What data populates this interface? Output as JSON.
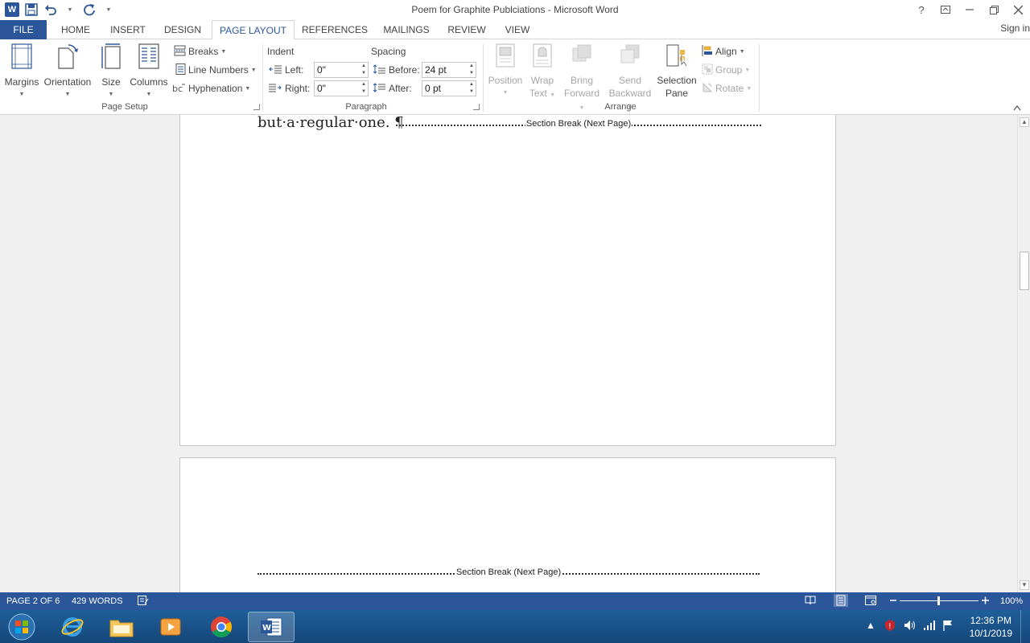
{
  "window": {
    "title": "Poem for Graphite Publciations - Microsoft Word",
    "app_icon": "W",
    "controls": [
      "?",
      "ribbon-display",
      "minimize",
      "restore",
      "close"
    ]
  },
  "tabs": [
    {
      "label": "FILE"
    },
    {
      "label": "HOME"
    },
    {
      "label": "INSERT"
    },
    {
      "label": "DESIGN"
    },
    {
      "label": "PAGE LAYOUT",
      "active": true
    },
    {
      "label": "REFERENCES"
    },
    {
      "label": "MAILINGS"
    },
    {
      "label": "REVIEW"
    },
    {
      "label": "VIEW"
    }
  ],
  "signin": "Sign in",
  "ribbon": {
    "page_setup": {
      "label": "Page Setup",
      "margins": "Margins",
      "orientation": "Orientation",
      "size": "Size",
      "columns": "Columns",
      "breaks": "Breaks",
      "line_numbers": "Line Numbers",
      "hyphenation": "Hyphenation"
    },
    "paragraph": {
      "label": "Paragraph",
      "indent_header": "Indent",
      "spacing_header": "Spacing",
      "left_label": "Left:",
      "left_value": "0\"",
      "right_label": "Right:",
      "right_value": "0\"",
      "before_label": "Before:",
      "before_value": "24 pt",
      "after_label": "After:",
      "after_value": "0 pt"
    },
    "arrange": {
      "label": "Arrange",
      "position": "Position",
      "wrap_text_1": "Wrap",
      "wrap_text_2": "Text",
      "bring_forward_1": "Bring",
      "bring_forward_2": "Forward",
      "send_backward_1": "Send",
      "send_backward_2": "Backward",
      "selection_pane_1": "Selection",
      "selection_pane_2": "Pane",
      "align": "Align",
      "group": "Group",
      "rotate": "Rotate"
    }
  },
  "document": {
    "page1_line": "but·a·regular·one.",
    "pilcrow": "¶",
    "section_break": "Section Break (Next Page)"
  },
  "status": {
    "page": "PAGE 2 OF 6",
    "words": "429 WORDS",
    "zoom": "100%"
  },
  "taskbar": {
    "time": "12:36 PM",
    "date": "10/1/2019"
  },
  "colors": {
    "accent": "#2b579a",
    "taskbar": "#1f5f99"
  }
}
